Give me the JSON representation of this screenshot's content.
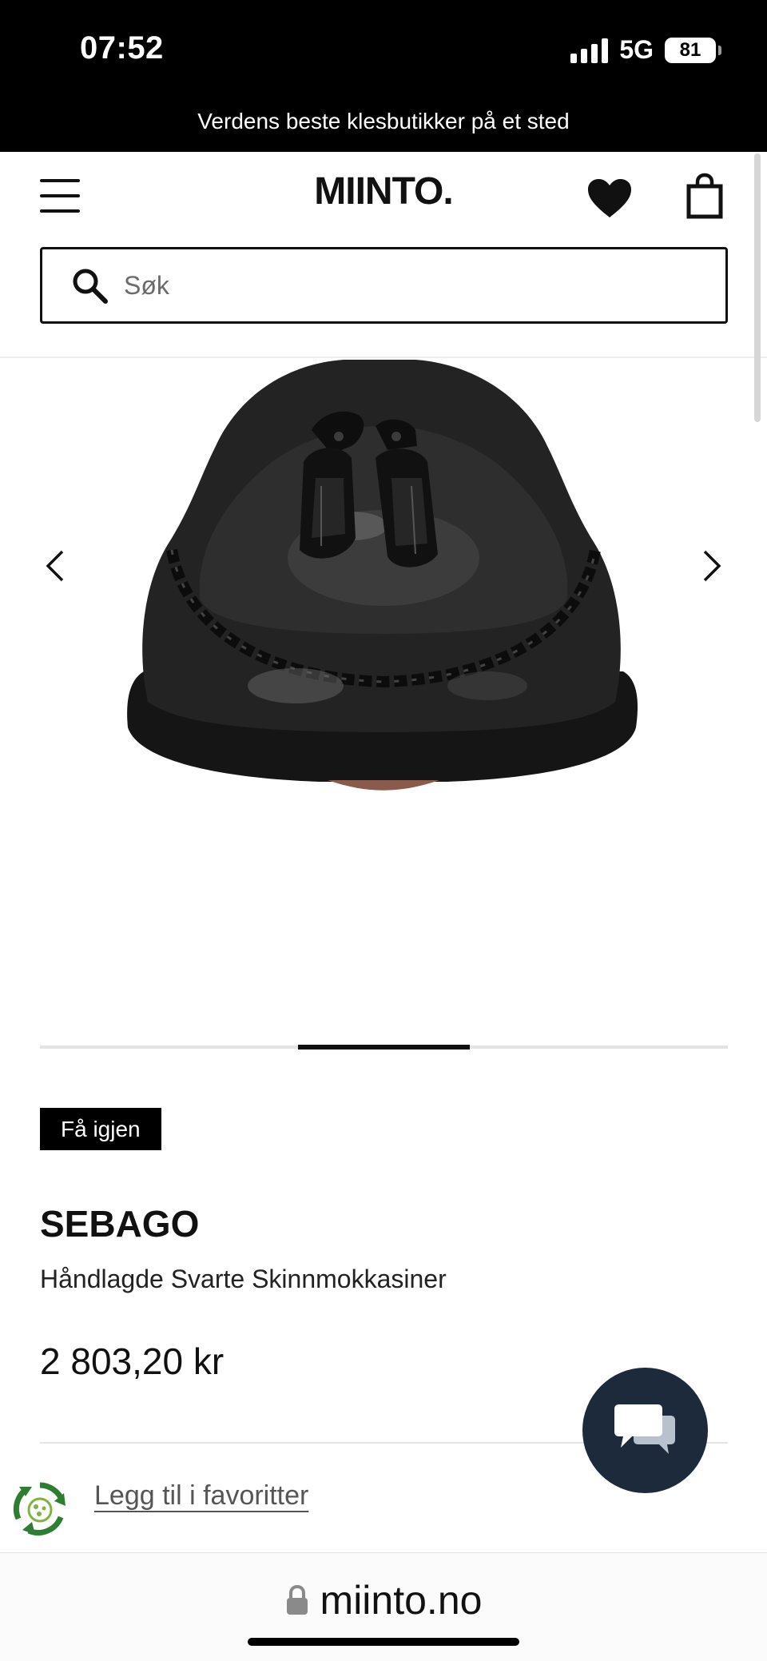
{
  "status_bar": {
    "time": "07:52",
    "network": "5G",
    "battery": "81"
  },
  "banner": {
    "text": "Verdens beste klesbutikker på et sted"
  },
  "header": {
    "logo": "MIINTO.",
    "menu_icon": "hamburger-menu-icon",
    "favorites_icon": "heart-icon",
    "bag_icon": "shopping-bag-icon"
  },
  "search": {
    "placeholder": "Søk",
    "value": ""
  },
  "gallery": {
    "image_alt": "Sort skinnmokkasin med dusker",
    "prev_icon": "chevron-left-icon",
    "next_icon": "chevron-right-icon",
    "current_slide": 2,
    "total_slides": 4
  },
  "product": {
    "badge": "Få igjen",
    "brand": "SEBAGO",
    "name": "Håndlagde Svarte Skinnmokkasiner",
    "price": "2 803,20 kr",
    "favorite_link": "Legg til i favoritter"
  },
  "chat": {
    "icon": "chat-bubbles-icon"
  },
  "browser": {
    "url": "miinto.no"
  },
  "colors": {
    "chat_button": "#1c2a3b",
    "eco_green": "#2e7d32",
    "banner_bg": "#000000"
  }
}
